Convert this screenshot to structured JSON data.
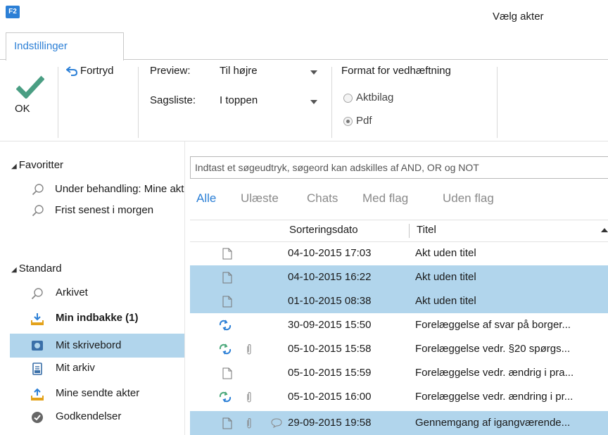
{
  "app": {
    "logo_text": "F2",
    "window_title": "Vælg akter"
  },
  "ribbon": {
    "tab_label": "Indstillinger",
    "ok_label": "OK",
    "undo_label": "Fortryd",
    "preview_label": "Preview:",
    "preview_value": "Til højre",
    "caselist_label": "Sagsliste:",
    "caselist_value": "I toppen",
    "format_label": "Format for vedhæftning",
    "format_options": [
      {
        "label": "Aktbilag",
        "selected": false
      },
      {
        "label": "Pdf",
        "selected": true
      }
    ]
  },
  "nav": {
    "favorites_header": "Favoritter",
    "favorites": [
      {
        "label": "Under behandling: Mine akter",
        "icon": "search-icon"
      },
      {
        "label": "Frist senest i morgen",
        "icon": "search-icon"
      }
    ],
    "standard_header": "Standard",
    "standard": [
      {
        "label": "Arkivet",
        "icon": "search-icon",
        "bold": false,
        "selected": false
      },
      {
        "label": "Min indbakke (1)",
        "icon": "inbox-icon",
        "bold": true,
        "selected": false
      },
      {
        "label": "Mit skrivebord",
        "icon": "desk-icon",
        "bold": false,
        "selected": true
      },
      {
        "label": "Mit arkiv",
        "icon": "archive-icon",
        "bold": false,
        "selected": false
      },
      {
        "label": "Mine sendte akter",
        "icon": "outbox-icon",
        "bold": false,
        "selected": false
      },
      {
        "label": "Godkendelser",
        "icon": "approval-icon",
        "bold": false,
        "selected": false
      }
    ]
  },
  "search": {
    "placeholder": "Indtast et søgeudtryk, søgeord kan adskilles af AND, OR og NOT"
  },
  "filters": [
    "Alle",
    "Ulæste",
    "Chats",
    "Med flag",
    "Uden flag"
  ],
  "list": {
    "columns": {
      "date": "Sorteringsdato",
      "title": "Titel"
    },
    "rows": [
      {
        "date": "04-10-2015 17:03",
        "title": "Akt uden titel",
        "selected": false,
        "icon": "document-icon",
        "attachment": false,
        "chat": false
      },
      {
        "date": "04-10-2015 16:22",
        "title": "Akt uden titel",
        "selected": true,
        "icon": "document-icon",
        "attachment": false,
        "chat": false
      },
      {
        "date": "01-10-2015 08:38",
        "title": "Akt uden titel",
        "selected": true,
        "icon": "document-icon",
        "attachment": false,
        "chat": false
      },
      {
        "date": "30-09-2015 15:50",
        "title": "Forelæggelse af svar på borger...",
        "selected": false,
        "icon": "thread-icon",
        "attachment": false,
        "chat": false
      },
      {
        "date": "05-10-2015 15:58",
        "title": "Forelæggelse vedr. §20 spørgs...",
        "selected": false,
        "icon": "thread-alt-icon",
        "attachment": true,
        "chat": false
      },
      {
        "date": "05-10-2015 15:59",
        "title": "Forelæggelse vedr. ændrig i pra...",
        "selected": false,
        "icon": "document-icon",
        "attachment": false,
        "chat": false
      },
      {
        "date": "05-10-2015 16:00",
        "title": "Forelæggelse vedr. ændring i pr...",
        "selected": false,
        "icon": "thread-alt-icon",
        "attachment": true,
        "chat": false
      },
      {
        "date": "29-09-2015 19:58",
        "title": "Gennemgang af igangværende...",
        "selected": true,
        "icon": "document-icon",
        "attachment": true,
        "chat": true
      }
    ]
  },
  "colors": {
    "accent": "#2b7fd6",
    "selection": "#b1d5ec",
    "ok_check": "#4a9e83"
  }
}
